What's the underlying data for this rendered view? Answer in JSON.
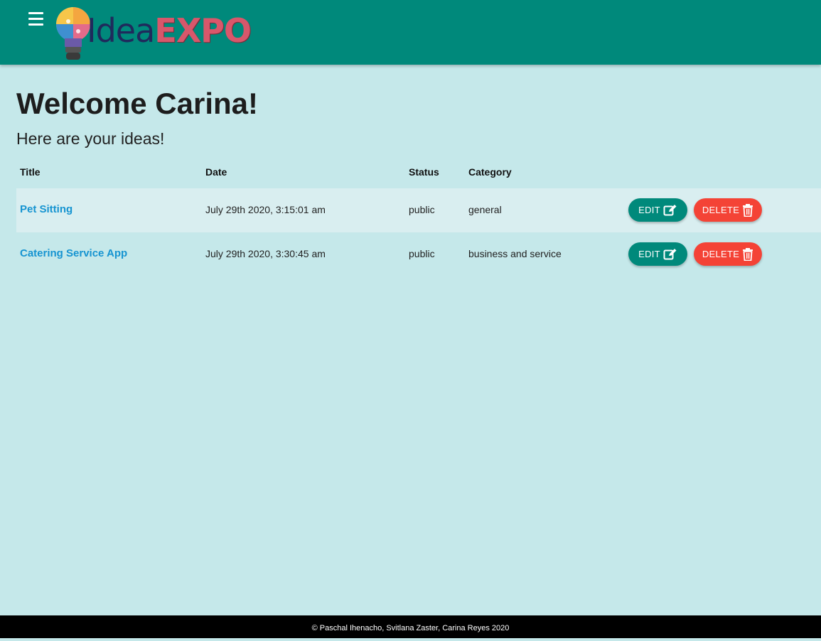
{
  "header": {
    "logo_word_1": "Idea",
    "logo_word_2": "EXPO",
    "menu_icon": "hamburger-menu-icon",
    "logo_icon": "lightbulb-puzzle-icon",
    "color": "#00897b"
  },
  "main": {
    "welcome": "Welcome Carina!",
    "subtitle": "Here are your ideas!",
    "columns": [
      "Title",
      "Date",
      "Status",
      "Category"
    ],
    "rows": [
      {
        "title": "Pet Sitting",
        "date": "July 29th 2020, 3:15:01 am",
        "status": "public",
        "category": "general",
        "edit_label": "EDIT",
        "delete_label": "DELETE"
      },
      {
        "title": "Catering Service App",
        "date": "July 29th 2020, 3:30:45 am",
        "status": "public",
        "category": "business and service",
        "edit_label": "EDIT",
        "delete_label": "DELETE"
      }
    ],
    "edit_icon": "edit-icon",
    "delete_icon": "trash-icon",
    "edit_color": "#00897b",
    "delete_color": "#f44336",
    "background": "#c5e8ea"
  },
  "footer": {
    "text": "© Paschal Ihenacho, Svitlana Zaster, Carina Reyes 2020"
  }
}
